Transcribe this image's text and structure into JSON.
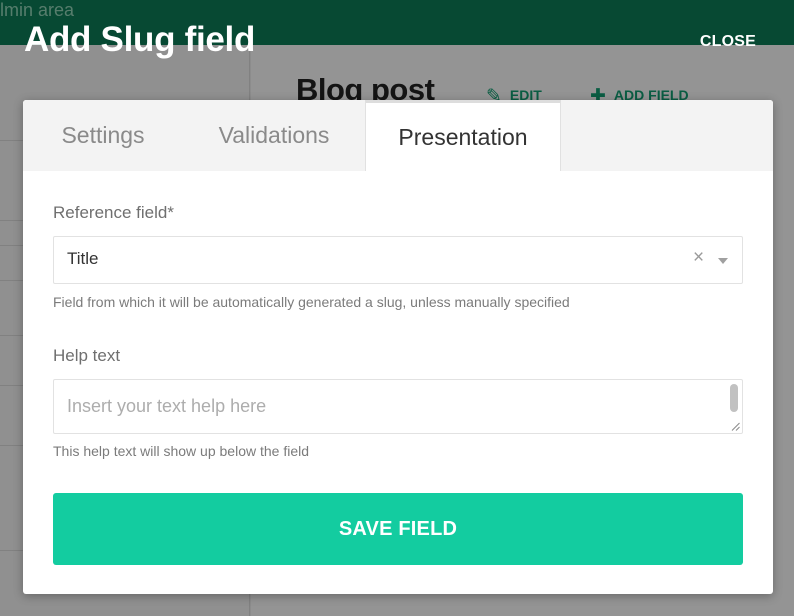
{
  "background": {
    "topbar_text": "lmin area",
    "page_title": "Blog post",
    "edit_label": "EDIT",
    "add_field_label": "ADD FIELD"
  },
  "modal": {
    "title": "Add Slug field",
    "close_label": "CLOSE",
    "tabs": [
      {
        "label": "Settings",
        "active": false
      },
      {
        "label": "Validations",
        "active": false
      },
      {
        "label": "Presentation",
        "active": true
      }
    ],
    "reference_field": {
      "label": "Reference field*",
      "value": "Title",
      "clear_glyph": "×",
      "hint": "Field from which it will be automatically generated a slug, unless manually specified"
    },
    "help_text": {
      "label": "Help text",
      "value": "",
      "placeholder": "Insert your text help here",
      "hint": "This help text will show up below the field"
    },
    "save_label": "SAVE FIELD"
  },
  "colors": {
    "brand_green": "#0d7a55",
    "accent": "#13cca0"
  },
  "icons": {
    "edit": "pencil-icon",
    "add": "plus-icon",
    "clear": "close-icon",
    "dropdown": "chevron-down-icon"
  }
}
